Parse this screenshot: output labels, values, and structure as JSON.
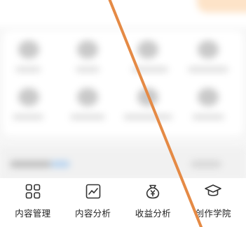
{
  "colors": {
    "stroke": "#e58a45",
    "banner_accent": "#fde3c8",
    "icon": "#333333",
    "label": "#222222"
  },
  "shortcuts": [
    {
      "label": "内容管理",
      "icon": "grid-icon"
    },
    {
      "label": "内容分析",
      "icon": "trend-chart-icon"
    },
    {
      "label": "收益分析",
      "icon": "money-bag-icon"
    },
    {
      "label": "创作学院",
      "icon": "graduation-cap-icon"
    }
  ]
}
